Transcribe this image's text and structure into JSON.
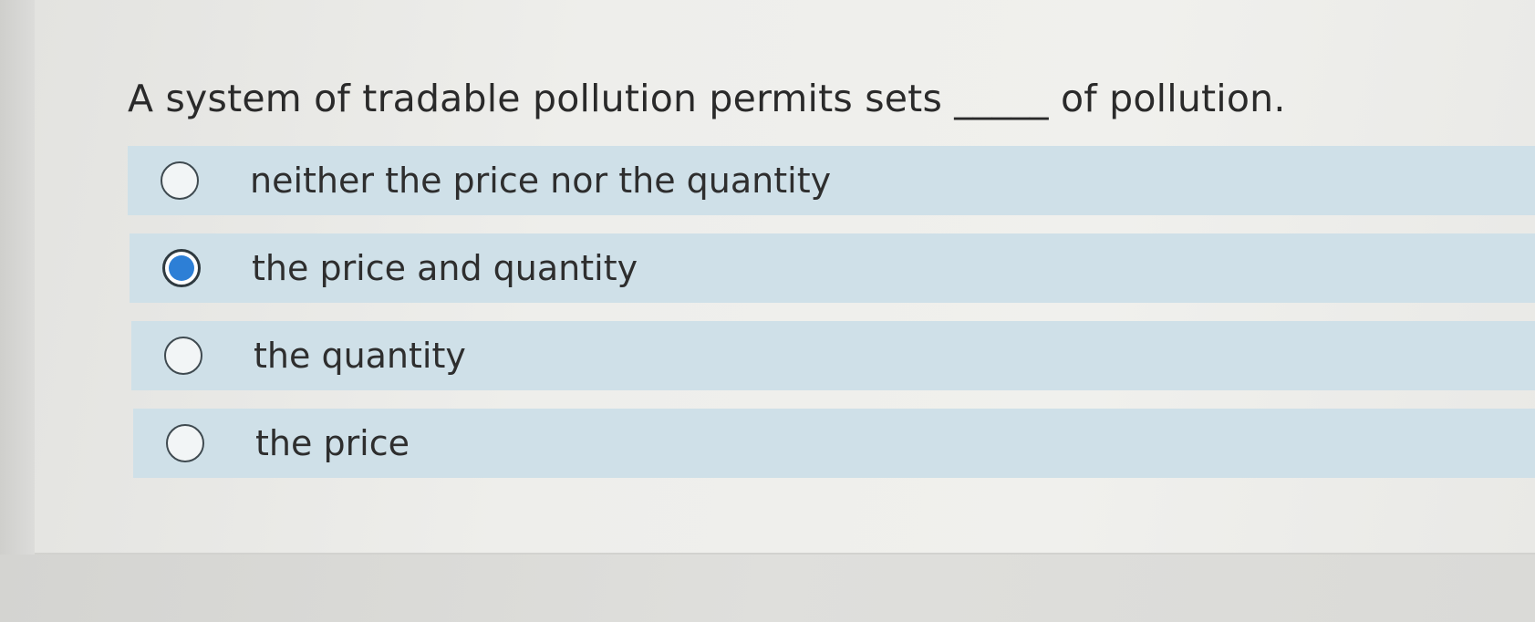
{
  "question": {
    "text": "A system of tradable pollution permits sets _____ of pollution."
  },
  "options": [
    {
      "label": "neither the price nor the quantity",
      "selected": false
    },
    {
      "label": "the price and quantity",
      "selected": true
    },
    {
      "label": "the quantity",
      "selected": false
    },
    {
      "label": "the price",
      "selected": false
    }
  ],
  "colors": {
    "option_background": "#cfe0e8",
    "selected_radio": "#2d7fd6",
    "text": "#2e2e2e"
  }
}
